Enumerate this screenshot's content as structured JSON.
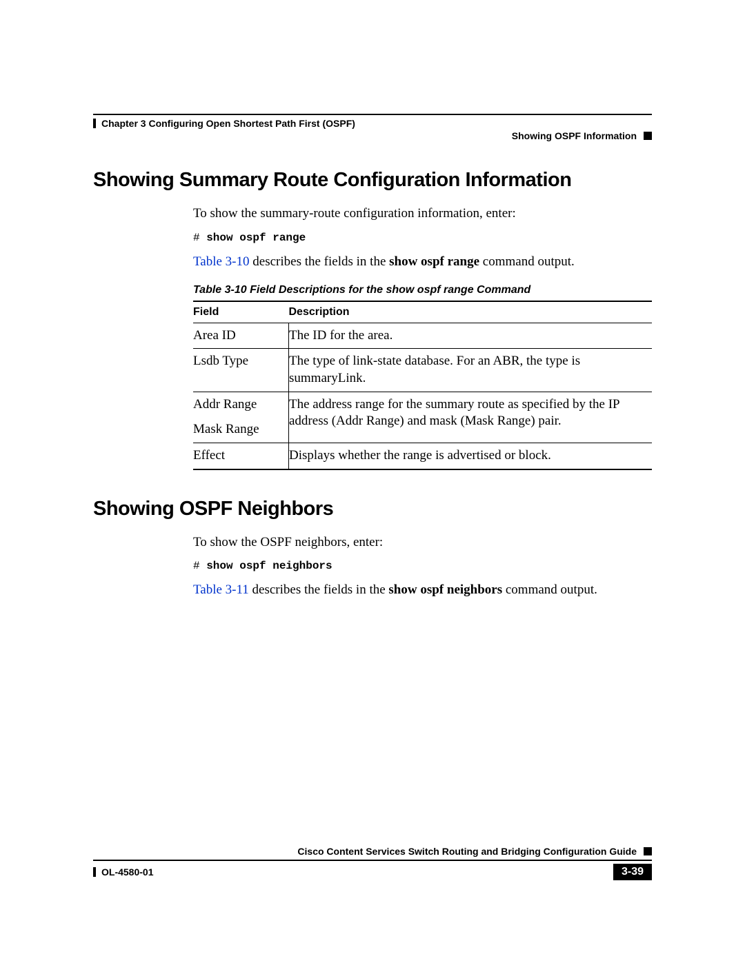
{
  "header": {
    "chapter": "Chapter 3      Configuring Open Shortest Path First (OSPF)",
    "section": "Showing OSPF Information"
  },
  "section1": {
    "heading": "Showing Summary Route Configuration Information",
    "intro": "To show the summary-route configuration information, enter:",
    "prompt": "# ",
    "command": "show ospf range",
    "desc_link": "Table 3-10",
    "desc_mid": " describes the fields in the ",
    "desc_bold": "show ospf range",
    "desc_end": " command output.",
    "caption": "Table 3-10   Field Descriptions for the show ospf range Command",
    "col_field": "Field",
    "col_desc": "Description",
    "rows": {
      "r0f": "Area ID",
      "r0d": "The ID for the area.",
      "r1f": "Lsdb Type",
      "r1d": "The type of link-state database. For an ABR, the type is summaryLink.",
      "r2f": "Addr Range",
      "r2d": "The address range for the summary route as specified by the IP address (Addr Range) and mask (Mask Range) pair.",
      "r3f": "Mask Range",
      "r4f": "Effect",
      "r4d": "Displays whether the range is advertised or block."
    }
  },
  "section2": {
    "heading": "Showing OSPF Neighbors",
    "intro": "To show the OSPF neighbors, enter:",
    "prompt": "# ",
    "command": "show ospf neighbors",
    "desc_link": "Table 3-11",
    "desc_mid": " describes the fields in the ",
    "desc_bold": "show ospf neighbors",
    "desc_end": " command output."
  },
  "footer": {
    "guide": "Cisco Content Services Switch Routing and Bridging Configuration Guide",
    "docnum": "OL-4580-01",
    "pagenum": "3-39"
  }
}
